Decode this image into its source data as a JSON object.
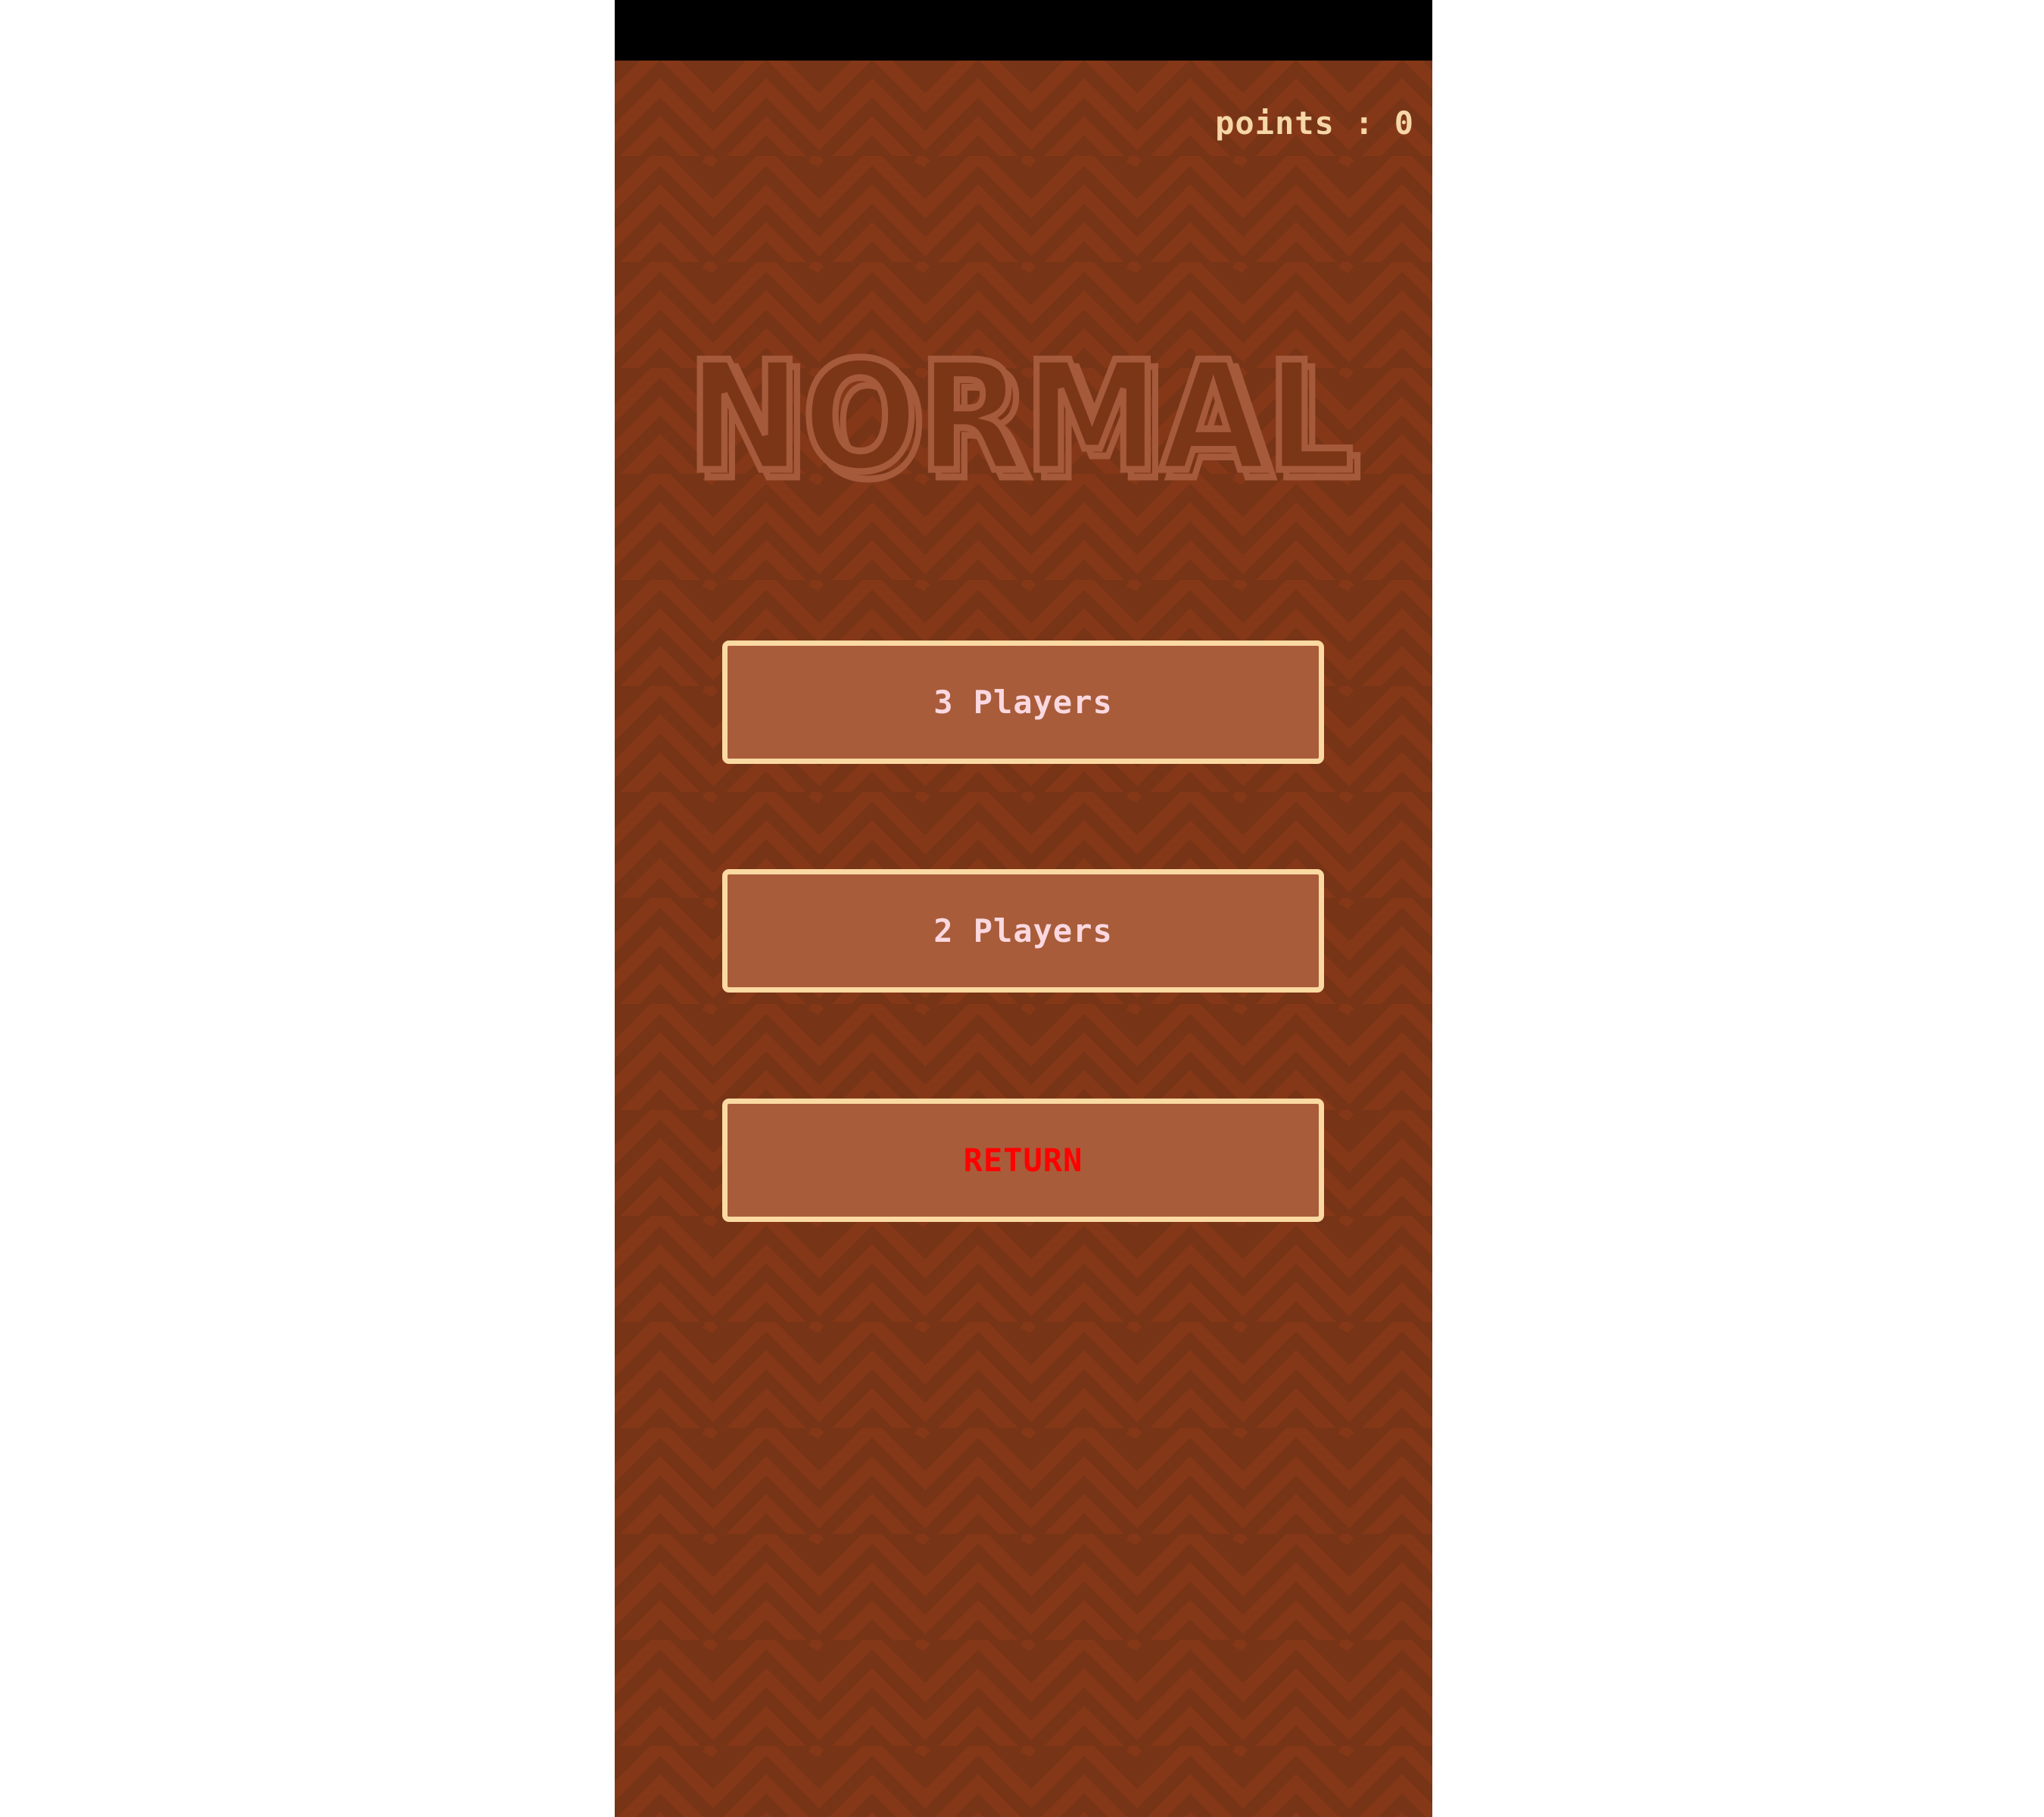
{
  "hud": {
    "points_text": "points : 0"
  },
  "title": {
    "text": "NORMAL"
  },
  "menu": {
    "three_players_label": "3 Players",
    "two_players_label": "2 Players",
    "return_label": "RETURN"
  },
  "colors": {
    "background": "#773416",
    "pattern_stripe": "#853817",
    "button_fill": "#a85c3a",
    "button_border": "#fbd9a2",
    "title_outline": "#a55a3b",
    "player_label": "#fbd8e0",
    "return_label": "#ff0000",
    "points_text": "#f6d7a7"
  }
}
